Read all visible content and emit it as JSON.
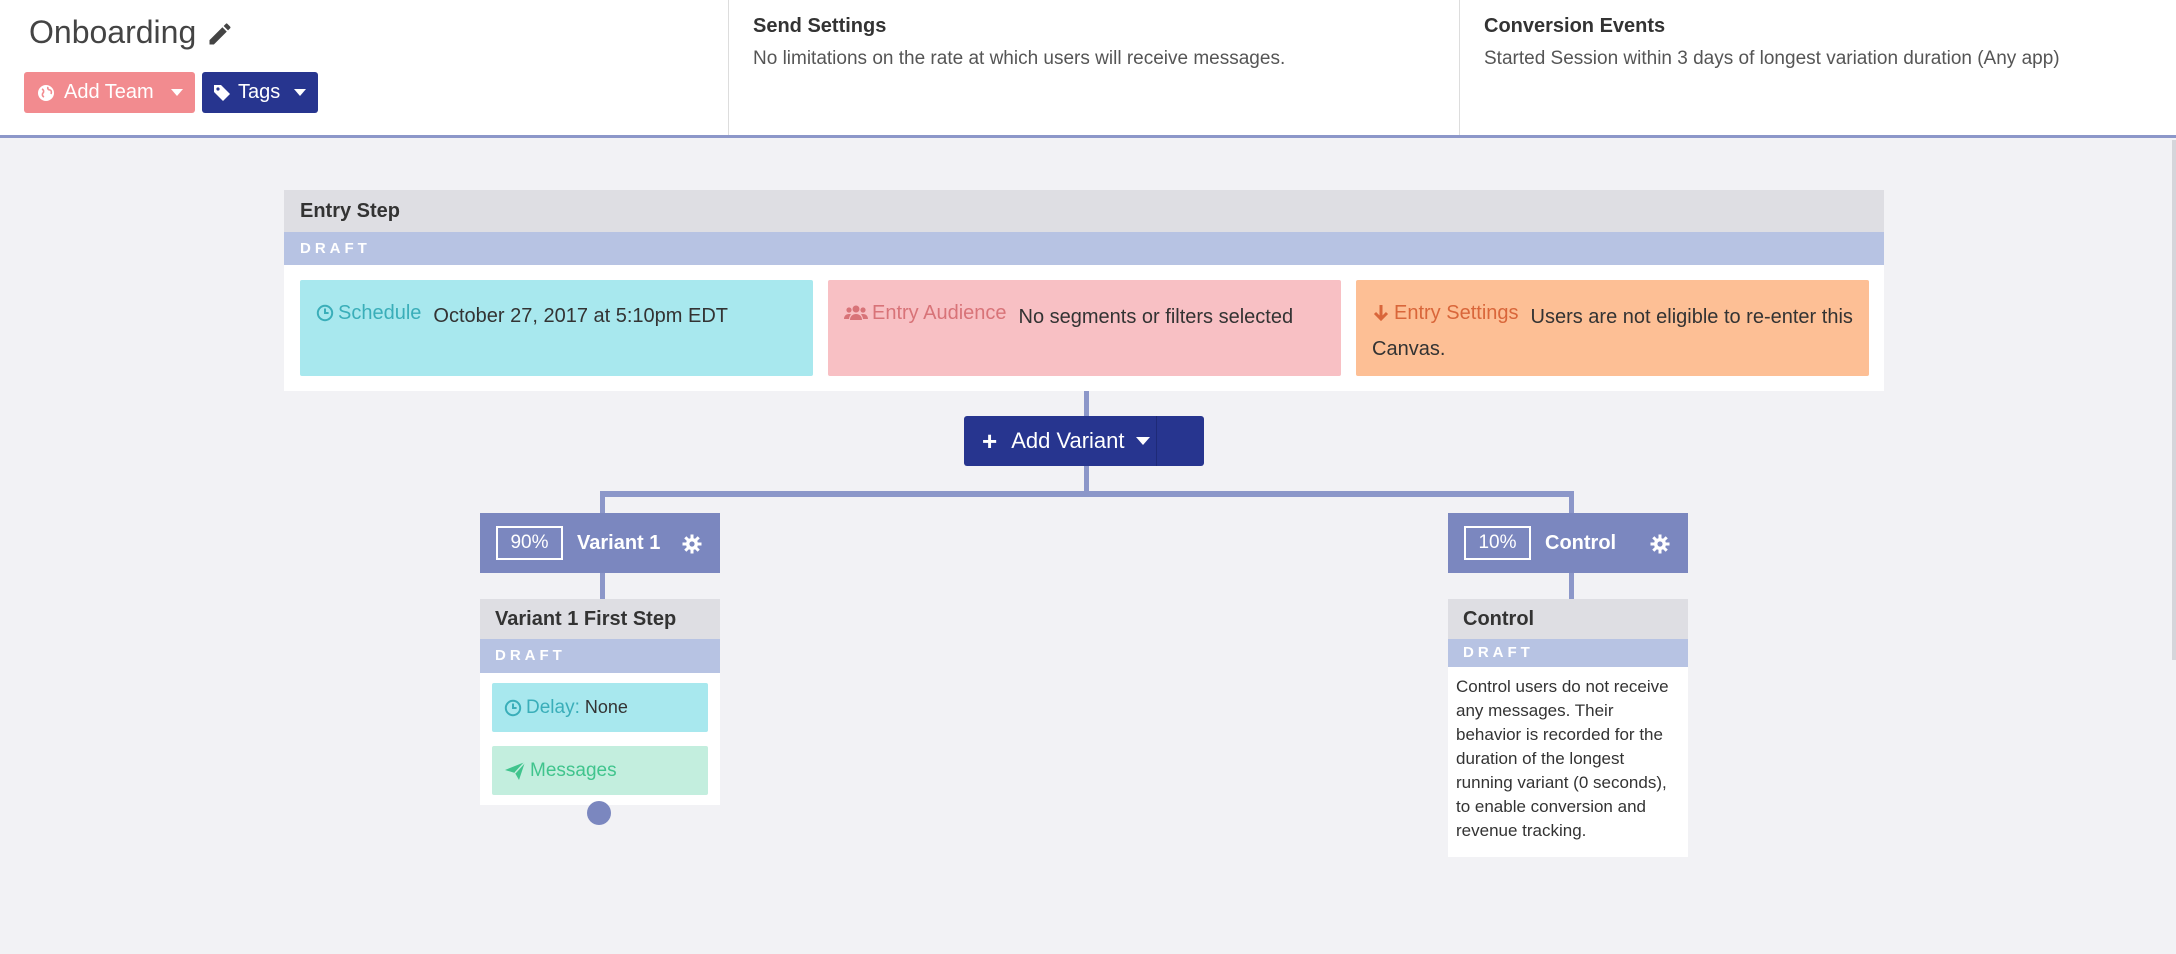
{
  "header": {
    "title": "Onboarding",
    "add_team_label": "Add Team",
    "tags_label": "Tags",
    "send_settings": {
      "heading": "Send Settings",
      "text": "No limitations on the rate at which users will receive messages."
    },
    "conversion_events": {
      "heading": "Conversion Events",
      "text": "Started Session within 3 days of longest variation duration (Any app)"
    }
  },
  "entry_step": {
    "title": "Entry Step",
    "status": "DRAFT",
    "schedule": {
      "label": "Schedule",
      "value": "October 27, 2017 at 5:10pm EDT"
    },
    "audience": {
      "label": "Entry Audience",
      "value": "No segments or filters selected"
    },
    "settings": {
      "label": "Entry Settings",
      "value": "Users are not eligible to re-enter this Canvas."
    }
  },
  "add_variant_label": "Add Variant",
  "variants": [
    {
      "percent": "90%",
      "name": "Variant 1",
      "step_title": "Variant 1 First Step",
      "status": "DRAFT",
      "delay_label": "Delay:",
      "delay_value": "None",
      "messages_label": "Messages"
    },
    {
      "percent": "10%",
      "name": "Control",
      "step_title": "Control",
      "status": "DRAFT",
      "description": "Control users do not receive any messages. Their behavior is recorded for the duration of the longest running variant (0 seconds), to enable conversion and revenue tracking."
    }
  ],
  "colors": {
    "primary": "#27358f",
    "variant_header": "#7b87bf",
    "draft_bar": "#b7c3e3",
    "add_team": "#f28b8f"
  }
}
